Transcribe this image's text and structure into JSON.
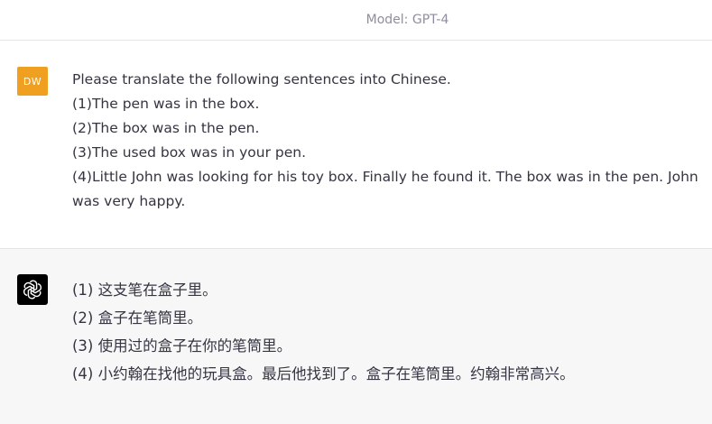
{
  "header": {
    "model_label": "Model: GPT-4"
  },
  "user_message": {
    "avatar_initials": "DW",
    "avatar_color": "#f0a020",
    "lines": [
      "Please translate the following sentences into Chinese.",
      "(1)The pen was in the box.",
      "(2)The box was in the pen.",
      "(3)The used box was in your pen.",
      "(4)Little John was looking for his toy box. Finally he found it. The box was in the pen. John was very happy."
    ]
  },
  "assistant_message": {
    "avatar_icon": "openai-logo-icon",
    "avatar_color": "#000000",
    "lines": [
      "(1) 这支笔在盒子里。",
      "(2) 盒子在笔筒里。",
      "(3) 使用过的盒子在你的笔筒里。",
      "(4) 小约翰在找他的玩具盒。最后他找到了。盒子在笔筒里。约翰非常高兴。"
    ]
  }
}
